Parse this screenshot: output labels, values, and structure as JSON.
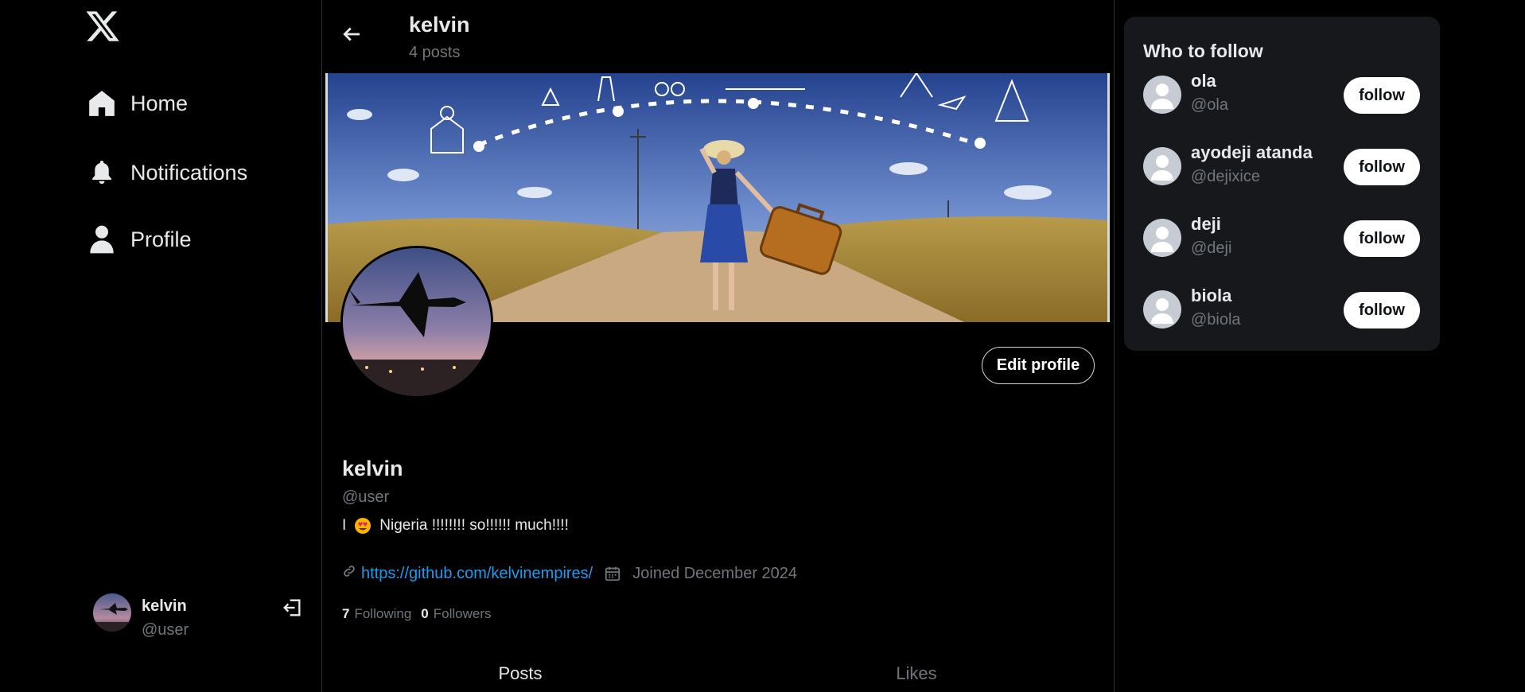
{
  "nav": {
    "logo": "x-logo",
    "items": [
      {
        "label": "Home",
        "icon": "home-icon"
      },
      {
        "label": "Notifications",
        "icon": "bell-icon"
      },
      {
        "label": "Profile",
        "icon": "user-icon"
      }
    ]
  },
  "account": {
    "name": "kelvin",
    "handle": "@user"
  },
  "header": {
    "name": "kelvin",
    "posts": "4 posts"
  },
  "profile": {
    "name": "kelvin",
    "handle": "@user",
    "bio_prefix": "I",
    "bio_suffix": "Nigeria !!!!!!!! so!!!!!! much!!!!",
    "link": "https://github.com/kelvinempires/",
    "joined": "Joined December 2024",
    "following_count": "7",
    "following_label": "Following",
    "followers_count": "0",
    "followers_label": "Followers",
    "edit_label": "Edit profile"
  },
  "tabs": [
    "Posts",
    "Likes"
  ],
  "who_to_follow": {
    "title": "Who to follow",
    "follow_label": "follow",
    "users": [
      {
        "name": "ola",
        "handle": "@ola"
      },
      {
        "name": "ayodeji atanda",
        "handle": "@dejixice"
      },
      {
        "name": "deji",
        "handle": "@deji"
      },
      {
        "name": "biola",
        "handle": "@biola"
      }
    ]
  },
  "colors": {
    "background": "#000000",
    "link": "#1d9bf0",
    "muted": "#71767b",
    "panel": "#16181c"
  }
}
